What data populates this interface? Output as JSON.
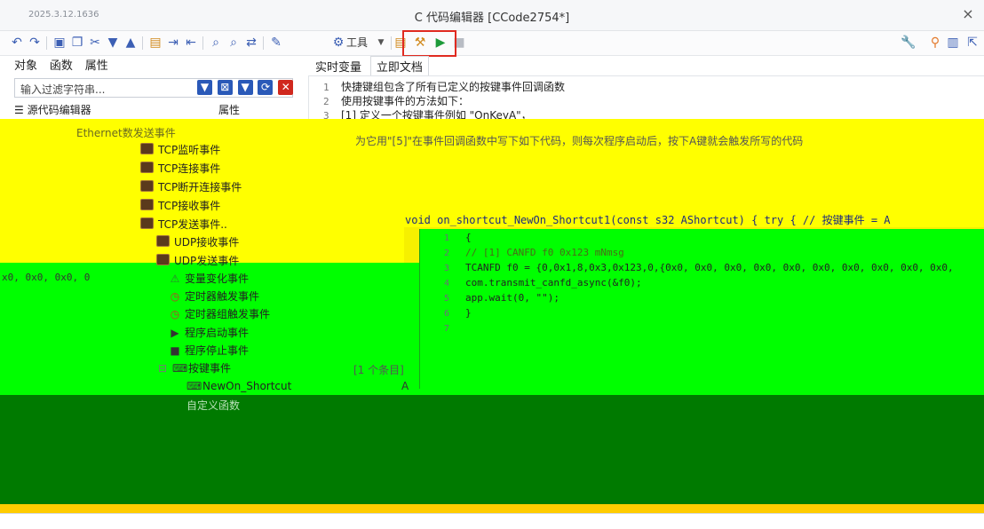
{
  "window": {
    "timestamp": "2025.3.12.1636",
    "title": "C 代码编辑器 [CCode2754*]",
    "close": "×"
  },
  "toolbar": {
    "tools_label": "工具"
  },
  "left_panel": {
    "tabs": [
      "对象",
      "函数",
      "属性"
    ],
    "filter_placeholder": "输入过滤字符串...",
    "tree_root": "源代码编辑器",
    "property_header": "属性"
  },
  "right_panel": {
    "tabs": [
      "实时变量",
      "立即文档"
    ],
    "doc_lines": [
      {
        "num": "1",
        "text": "快捷键组包含了所有已定义的按键事件回调函数"
      },
      {
        "num": "2",
        "text": "使用按键事件的方法如下："
      },
      {
        "num": "3",
        "text": "[1] 定义一个按键事件例如 \"OnKeyA\"，"
      }
    ]
  },
  "tree": {
    "ethernet_item": "Ethernet数发送事件",
    "items": [
      {
        "label": "TCP监听事件",
        "kind": "tcp"
      },
      {
        "label": "TCP连接事件",
        "kind": "tcp"
      },
      {
        "label": "TCP断开连接事件",
        "kind": "tcp"
      },
      {
        "label": "TCP接收事件",
        "kind": "tcp"
      },
      {
        "label": "TCP发送事件..",
        "kind": "tcp"
      },
      {
        "label": "UDP接收事件",
        "kind": "tcp"
      },
      {
        "label": "UDP发送事件",
        "kind": "tcp"
      },
      {
        "label": "变量变化事件",
        "kind": "var"
      },
      {
        "label": "定时器触发事件",
        "kind": "timer"
      },
      {
        "label": "定时器组触发事件",
        "kind": "timer"
      },
      {
        "label": "程序启动事件",
        "kind": "play"
      },
      {
        "label": "程序停止事件",
        "kind": "stop"
      },
      {
        "label": "按键事件",
        "kind": "key"
      },
      {
        "label": "NewOn_Shortcut",
        "kind": "key"
      },
      {
        "label": "自定义函数",
        "kind": "fn"
      }
    ],
    "count_label": "[1 个条目]",
    "shortcut_value": "A",
    "instruction_line": "为它用\"[5]\"在事件回调函数中写下如下代码，则每次程序启动后，按下A键就会触发所写的代码"
  },
  "code": {
    "signature": "void on_shortcut_NewOn_Shortcut1(const s32 AShortcut) { try { // 按键事件 = A",
    "lines": [
      {
        "num": "1",
        "text": "{"
      },
      {
        "num": "2",
        "text": "// [1] CANFD f0 0x123 mNmsg"
      },
      {
        "num": "3",
        "text": "TCANFD f0 = {0,0x1,8,0x3,0x123,0,{0x0, 0x0, 0x0, 0x0, 0x0, 0x0, 0x0, 0x0, 0x0, 0x0,"
      },
      {
        "num": "4",
        "text": "com.transmit_canfd_async(&f0);"
      },
      {
        "num": "5",
        "text": "app.wait(0, \"\");"
      },
      {
        "num": "6",
        "text": "}"
      },
      {
        "num": "7",
        "text": ""
      }
    ],
    "hex_left": "x0, 0x0, 0x0, 0"
  },
  "colors": {
    "highlight_box": "#e02a20",
    "overlay_yellow": "#ffff00",
    "overlay_green": "#00ff00",
    "overlay_dark_green": "#007a00"
  }
}
